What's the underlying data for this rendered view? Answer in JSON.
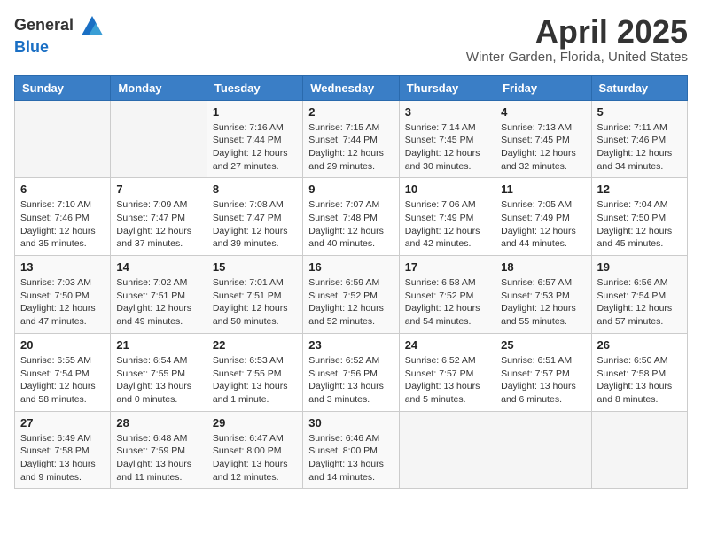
{
  "header": {
    "logo": {
      "general": "General",
      "blue": "Blue"
    },
    "title": "April 2025",
    "location": "Winter Garden, Florida, United States"
  },
  "calendar": {
    "weekdays": [
      "Sunday",
      "Monday",
      "Tuesday",
      "Wednesday",
      "Thursday",
      "Friday",
      "Saturday"
    ],
    "weeks": [
      [
        {
          "day": "",
          "info": ""
        },
        {
          "day": "",
          "info": ""
        },
        {
          "day": "1",
          "info": "Sunrise: 7:16 AM\nSunset: 7:44 PM\nDaylight: 12 hours\nand 27 minutes."
        },
        {
          "day": "2",
          "info": "Sunrise: 7:15 AM\nSunset: 7:44 PM\nDaylight: 12 hours\nand 29 minutes."
        },
        {
          "day": "3",
          "info": "Sunrise: 7:14 AM\nSunset: 7:45 PM\nDaylight: 12 hours\nand 30 minutes."
        },
        {
          "day": "4",
          "info": "Sunrise: 7:13 AM\nSunset: 7:45 PM\nDaylight: 12 hours\nand 32 minutes."
        },
        {
          "day": "5",
          "info": "Sunrise: 7:11 AM\nSunset: 7:46 PM\nDaylight: 12 hours\nand 34 minutes."
        }
      ],
      [
        {
          "day": "6",
          "info": "Sunrise: 7:10 AM\nSunset: 7:46 PM\nDaylight: 12 hours\nand 35 minutes."
        },
        {
          "day": "7",
          "info": "Sunrise: 7:09 AM\nSunset: 7:47 PM\nDaylight: 12 hours\nand 37 minutes."
        },
        {
          "day": "8",
          "info": "Sunrise: 7:08 AM\nSunset: 7:47 PM\nDaylight: 12 hours\nand 39 minutes."
        },
        {
          "day": "9",
          "info": "Sunrise: 7:07 AM\nSunset: 7:48 PM\nDaylight: 12 hours\nand 40 minutes."
        },
        {
          "day": "10",
          "info": "Sunrise: 7:06 AM\nSunset: 7:49 PM\nDaylight: 12 hours\nand 42 minutes."
        },
        {
          "day": "11",
          "info": "Sunrise: 7:05 AM\nSunset: 7:49 PM\nDaylight: 12 hours\nand 44 minutes."
        },
        {
          "day": "12",
          "info": "Sunrise: 7:04 AM\nSunset: 7:50 PM\nDaylight: 12 hours\nand 45 minutes."
        }
      ],
      [
        {
          "day": "13",
          "info": "Sunrise: 7:03 AM\nSunset: 7:50 PM\nDaylight: 12 hours\nand 47 minutes."
        },
        {
          "day": "14",
          "info": "Sunrise: 7:02 AM\nSunset: 7:51 PM\nDaylight: 12 hours\nand 49 minutes."
        },
        {
          "day": "15",
          "info": "Sunrise: 7:01 AM\nSunset: 7:51 PM\nDaylight: 12 hours\nand 50 minutes."
        },
        {
          "day": "16",
          "info": "Sunrise: 6:59 AM\nSunset: 7:52 PM\nDaylight: 12 hours\nand 52 minutes."
        },
        {
          "day": "17",
          "info": "Sunrise: 6:58 AM\nSunset: 7:52 PM\nDaylight: 12 hours\nand 54 minutes."
        },
        {
          "day": "18",
          "info": "Sunrise: 6:57 AM\nSunset: 7:53 PM\nDaylight: 12 hours\nand 55 minutes."
        },
        {
          "day": "19",
          "info": "Sunrise: 6:56 AM\nSunset: 7:54 PM\nDaylight: 12 hours\nand 57 minutes."
        }
      ],
      [
        {
          "day": "20",
          "info": "Sunrise: 6:55 AM\nSunset: 7:54 PM\nDaylight: 12 hours\nand 58 minutes."
        },
        {
          "day": "21",
          "info": "Sunrise: 6:54 AM\nSunset: 7:55 PM\nDaylight: 13 hours\nand 0 minutes."
        },
        {
          "day": "22",
          "info": "Sunrise: 6:53 AM\nSunset: 7:55 PM\nDaylight: 13 hours\nand 1 minute."
        },
        {
          "day": "23",
          "info": "Sunrise: 6:52 AM\nSunset: 7:56 PM\nDaylight: 13 hours\nand 3 minutes."
        },
        {
          "day": "24",
          "info": "Sunrise: 6:52 AM\nSunset: 7:57 PM\nDaylight: 13 hours\nand 5 minutes."
        },
        {
          "day": "25",
          "info": "Sunrise: 6:51 AM\nSunset: 7:57 PM\nDaylight: 13 hours\nand 6 minutes."
        },
        {
          "day": "26",
          "info": "Sunrise: 6:50 AM\nSunset: 7:58 PM\nDaylight: 13 hours\nand 8 minutes."
        }
      ],
      [
        {
          "day": "27",
          "info": "Sunrise: 6:49 AM\nSunset: 7:58 PM\nDaylight: 13 hours\nand 9 minutes."
        },
        {
          "day": "28",
          "info": "Sunrise: 6:48 AM\nSunset: 7:59 PM\nDaylight: 13 hours\nand 11 minutes."
        },
        {
          "day": "29",
          "info": "Sunrise: 6:47 AM\nSunset: 8:00 PM\nDaylight: 13 hours\nand 12 minutes."
        },
        {
          "day": "30",
          "info": "Sunrise: 6:46 AM\nSunset: 8:00 PM\nDaylight: 13 hours\nand 14 minutes."
        },
        {
          "day": "",
          "info": ""
        },
        {
          "day": "",
          "info": ""
        },
        {
          "day": "",
          "info": ""
        }
      ]
    ]
  }
}
